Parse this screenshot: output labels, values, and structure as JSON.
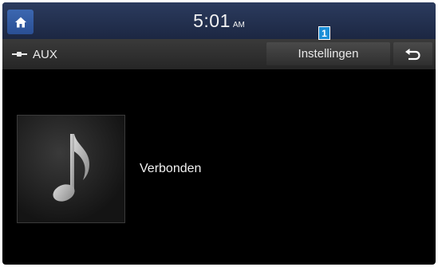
{
  "status_bar": {
    "time": "5:01",
    "ampm": "AM",
    "home_icon": "home-icon"
  },
  "callout": {
    "label": "1",
    "color": "#1b8fd8"
  },
  "sub_header": {
    "source_label": "AUX",
    "source_icon": "aux-cable-icon",
    "settings_label": "Instellingen",
    "back_icon": "back-arrow-icon"
  },
  "main": {
    "album_icon": "music-note-icon",
    "status_text": "Verbonden"
  }
}
